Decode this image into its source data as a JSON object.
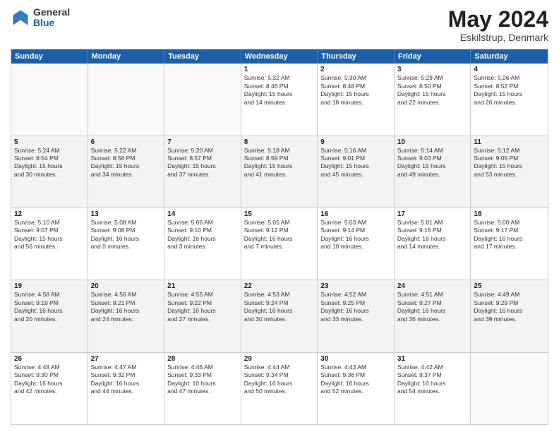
{
  "header": {
    "logo_general": "General",
    "logo_blue": "Blue",
    "title": "May 2024",
    "location": "Eskilstrup, Denmark"
  },
  "days_of_week": [
    "Sunday",
    "Monday",
    "Tuesday",
    "Wednesday",
    "Thursday",
    "Friday",
    "Saturday"
  ],
  "weeks": [
    [
      {
        "day": "",
        "info": ""
      },
      {
        "day": "",
        "info": ""
      },
      {
        "day": "",
        "info": ""
      },
      {
        "day": "1",
        "info": "Sunrise: 5:32 AM\nSunset: 8:46 PM\nDaylight: 15 hours\nand 14 minutes."
      },
      {
        "day": "2",
        "info": "Sunrise: 5:30 AM\nSunset: 8:48 PM\nDaylight: 15 hours\nand 18 minutes."
      },
      {
        "day": "3",
        "info": "Sunrise: 5:28 AM\nSunset: 8:50 PM\nDaylight: 15 hours\nand 22 minutes."
      },
      {
        "day": "4",
        "info": "Sunrise: 5:26 AM\nSunset: 8:52 PM\nDaylight: 15 hours\nand 26 minutes."
      }
    ],
    [
      {
        "day": "5",
        "info": "Sunrise: 5:24 AM\nSunset: 8:54 PM\nDaylight: 15 hours\nand 30 minutes."
      },
      {
        "day": "6",
        "info": "Sunrise: 5:22 AM\nSunset: 8:56 PM\nDaylight: 15 hours\nand 34 minutes."
      },
      {
        "day": "7",
        "info": "Sunrise: 5:20 AM\nSunset: 8:57 PM\nDaylight: 15 hours\nand 37 minutes."
      },
      {
        "day": "8",
        "info": "Sunrise: 5:18 AM\nSunset: 8:59 PM\nDaylight: 15 hours\nand 41 minutes."
      },
      {
        "day": "9",
        "info": "Sunrise: 5:16 AM\nSunset: 9:01 PM\nDaylight: 15 hours\nand 45 minutes."
      },
      {
        "day": "10",
        "info": "Sunrise: 5:14 AM\nSunset: 9:03 PM\nDaylight: 15 hours\nand 49 minutes."
      },
      {
        "day": "11",
        "info": "Sunrise: 5:12 AM\nSunset: 9:05 PM\nDaylight: 15 hours\nand 53 minutes."
      }
    ],
    [
      {
        "day": "12",
        "info": "Sunrise: 5:10 AM\nSunset: 9:07 PM\nDaylight: 15 hours\nand 56 minutes."
      },
      {
        "day": "13",
        "info": "Sunrise: 5:08 AM\nSunset: 9:08 PM\nDaylight: 16 hours\nand 0 minutes."
      },
      {
        "day": "14",
        "info": "Sunrise: 5:06 AM\nSunset: 9:10 PM\nDaylight: 16 hours\nand 3 minutes."
      },
      {
        "day": "15",
        "info": "Sunrise: 5:05 AM\nSunset: 9:12 PM\nDaylight: 16 hours\nand 7 minutes."
      },
      {
        "day": "16",
        "info": "Sunrise: 5:03 AM\nSunset: 9:14 PM\nDaylight: 16 hours\nand 10 minutes."
      },
      {
        "day": "17",
        "info": "Sunrise: 5:01 AM\nSunset: 9:16 PM\nDaylight: 16 hours\nand 14 minutes."
      },
      {
        "day": "18",
        "info": "Sunrise: 5:00 AM\nSunset: 9:17 PM\nDaylight: 16 hours\nand 17 minutes."
      }
    ],
    [
      {
        "day": "19",
        "info": "Sunrise: 4:58 AM\nSunset: 9:19 PM\nDaylight: 16 hours\nand 20 minutes."
      },
      {
        "day": "20",
        "info": "Sunrise: 4:56 AM\nSunset: 9:21 PM\nDaylight: 16 hours\nand 24 minutes."
      },
      {
        "day": "21",
        "info": "Sunrise: 4:55 AM\nSunset: 9:22 PM\nDaylight: 16 hours\nand 27 minutes."
      },
      {
        "day": "22",
        "info": "Sunrise: 4:53 AM\nSunset: 9:24 PM\nDaylight: 16 hours\nand 30 minutes."
      },
      {
        "day": "23",
        "info": "Sunrise: 4:52 AM\nSunset: 9:25 PM\nDaylight: 16 hours\nand 33 minutes."
      },
      {
        "day": "24",
        "info": "Sunrise: 4:51 AM\nSunset: 9:27 PM\nDaylight: 16 hours\nand 36 minutes."
      },
      {
        "day": "25",
        "info": "Sunrise: 4:49 AM\nSunset: 9:29 PM\nDaylight: 16 hours\nand 39 minutes."
      }
    ],
    [
      {
        "day": "26",
        "info": "Sunrise: 4:48 AM\nSunset: 9:30 PM\nDaylight: 16 hours\nand 42 minutes."
      },
      {
        "day": "27",
        "info": "Sunrise: 4:47 AM\nSunset: 9:32 PM\nDaylight: 16 hours\nand 44 minutes."
      },
      {
        "day": "28",
        "info": "Sunrise: 4:46 AM\nSunset: 9:33 PM\nDaylight: 16 hours\nand 47 minutes."
      },
      {
        "day": "29",
        "info": "Sunrise: 4:44 AM\nSunset: 9:34 PM\nDaylight: 16 hours\nand 50 minutes."
      },
      {
        "day": "30",
        "info": "Sunrise: 4:43 AM\nSunset: 9:36 PM\nDaylight: 16 hours\nand 52 minutes."
      },
      {
        "day": "31",
        "info": "Sunrise: 4:42 AM\nSunset: 9:37 PM\nDaylight: 16 hours\nand 54 minutes."
      },
      {
        "day": "",
        "info": ""
      }
    ]
  ]
}
